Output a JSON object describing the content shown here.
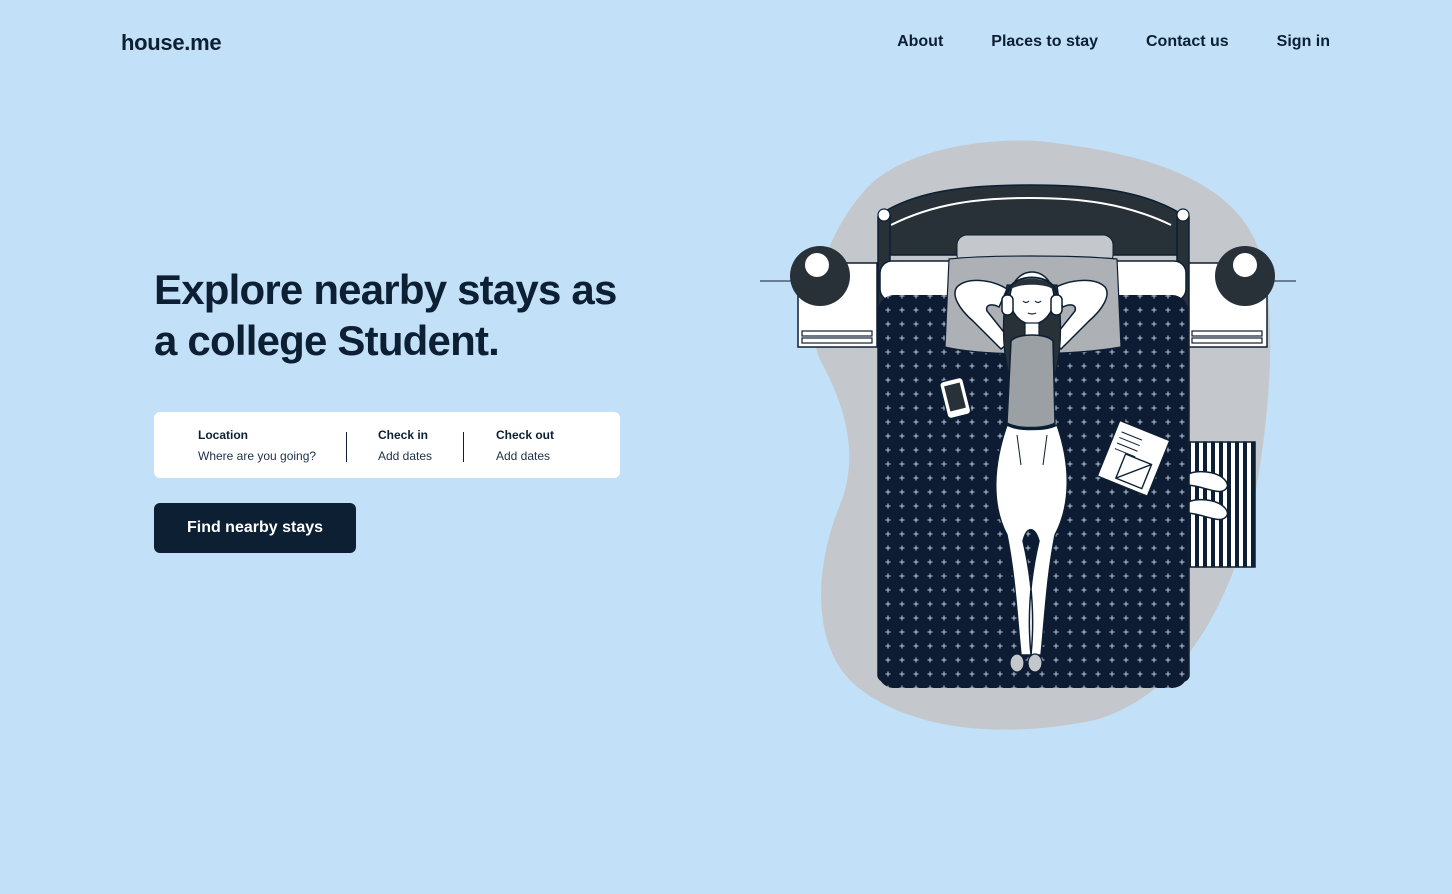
{
  "brand": {
    "logo": "house.me"
  },
  "nav": {
    "items": [
      "About",
      "Places to stay",
      "Contact us",
      "Sign in"
    ]
  },
  "hero": {
    "headline_line1": "Explore nearby stays as",
    "headline_line2": "a college Student."
  },
  "search": {
    "location_label": "Location",
    "location_placeholder": "Where are you going?",
    "checkin_label": "Check in",
    "checkin_placeholder": "Add dates",
    "checkout_label": "Check out",
    "checkout_placeholder": "Add dates"
  },
  "cta": {
    "label": "Find nearby stays"
  },
  "colors": {
    "background": "#c2e0f8",
    "primary": "#0c1f33",
    "card": "#ffffff",
    "blanket": "#0e1c33"
  },
  "illustration": {
    "name": "student-relaxing-on-bed-illustration"
  }
}
